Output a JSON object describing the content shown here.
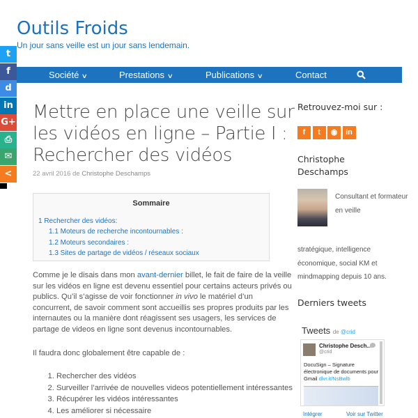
{
  "site": {
    "title": "Outils Froids",
    "tagline": "Un jour sans veille est un jour sans lendemain."
  },
  "nav": {
    "items": [
      "Société",
      "Prestations",
      "Publications",
      "Contact"
    ],
    "search_icon": "search-icon"
  },
  "share": [
    {
      "glyph": "t",
      "icon": "twitter-icon",
      "color": "#1da1f2"
    },
    {
      "glyph": "f",
      "icon": "facebook-icon",
      "color": "#3b5998"
    },
    {
      "glyph": "d",
      "icon": "diigo-icon",
      "color": "#3c8be4"
    },
    {
      "glyph": "in",
      "icon": "linkedin-icon",
      "color": "#0077b5"
    },
    {
      "glyph": "G+",
      "icon": "google-plus-icon",
      "color": "#dd4b39"
    },
    {
      "glyph": "⎙",
      "icon": "print-icon",
      "color": "#2ab28e"
    },
    {
      "glyph": "✉",
      "icon": "email-icon",
      "color": "#3aa56c"
    },
    {
      "glyph": "<",
      "icon": "share-icon",
      "color": "#f47b20"
    }
  ],
  "article": {
    "title": "Mettre en place une veille sur les vidéos en ligne – Partie I : Rechercher des vidéos",
    "date": "22 avril 2016",
    "by": "de",
    "author": "Christophe Deschamps",
    "toc": {
      "title": "Sommaire",
      "items": [
        "1 Rechercher des vidéos:",
        "1.1 Moteurs de recherche incontournables :",
        "1.2 Moteurs secondaires :",
        "1.3 Sites de partage de vidéos / réseaux sociaux"
      ]
    },
    "para1_a": "Comme je le disais dans mon ",
    "para1_link": "avant-dernier",
    "para1_b": " billet, le fait de faire de la veille sur les vidéos en ligne est devenu essentiel pour certains acteurs privés ou publics. Qu’il s’agisse de voir fonctionner ",
    "para1_em": "in vivo",
    "para1_c": " le matériel d’un concurrent, de savoir comment sont accueillis ses propres produits par les internautes ou la manière dont réagissent ses usagers, les services de partage de videos en ligne sont devenus incontournables.",
    "para2": "Il faudra donc globalement être capable de :",
    "list": [
      "Rechercher des vidéos",
      "Surveiller l’arrivée de nouvelles videos potentiellement intéressantes",
      "Récupérer les vidéos intéressantes",
      "Les améliorer si nécessaire"
    ]
  },
  "sidebar": {
    "find_me": "Retrouvez-moi sur :",
    "social": [
      {
        "glyph": "f",
        "icon": "facebook-icon"
      },
      {
        "glyph": "t",
        "icon": "twitter-icon"
      },
      {
        "glyph": "◉",
        "icon": "rss-icon"
      },
      {
        "glyph": "in",
        "icon": "linkedin-icon"
      }
    ],
    "author_name": "Christophe Deschamps",
    "bio_top": "Consultant et formateur en veille",
    "bio_bottom": "stratégique, intelligence économique, social KM et mindmapping depuis 10 ans.",
    "tweets_heading": "Derniers tweets",
    "twitter": {
      "title": "Tweets",
      "by": "de",
      "handle": "@crid",
      "tweet_name": "Christophe Desch...",
      "tweet_handle": "@crid",
      "tweet_text": "DocuSign – Signature électronique de documents pour Gmail",
      "tweet_link": "dlvr.it/NsBwlb",
      "embed": "Intégrer",
      "view": "Voir sur Twitter"
    }
  }
}
